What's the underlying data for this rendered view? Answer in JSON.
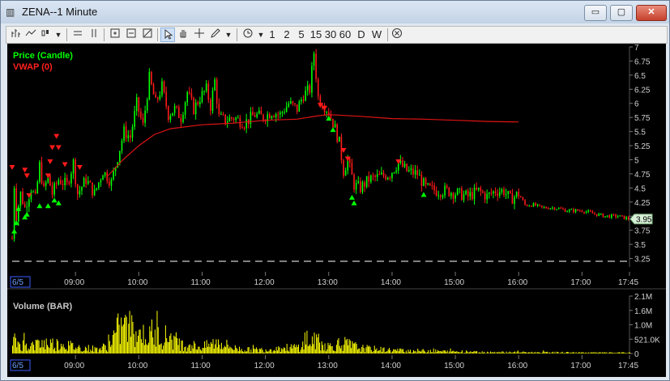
{
  "window": {
    "title": "ZENA--1 Minute",
    "controls": {
      "minimize": "▭",
      "maximize": "▢",
      "close": "✕"
    }
  },
  "toolbar": {
    "icons": [
      "bar-chart-style-icon",
      "line-chart-style-icon",
      "candle-style-icon",
      "dropdown-icon",
      "horizontal-line-icon",
      "vertical-lines-icon",
      "zoom-fit-icon",
      "zoom-in-icon",
      "zoom-out-icon",
      "pointer-icon",
      "hand-pan-icon",
      "crosshair-icon",
      "pen-draw-icon",
      "dropdown-icon",
      "clock-icon",
      "dropdown-icon"
    ],
    "intervals": [
      "1",
      "2",
      "5",
      "15",
      "30",
      "60",
      "D",
      "W"
    ]
  },
  "colors": {
    "price_up": "#00ff00",
    "price_down": "#ff1a1a",
    "vwap": "#e01414",
    "volume": "#ffff00",
    "axis_text": "#d0d0d0",
    "price_legend": "#00ff00",
    "vwap_legend": "#ff2020",
    "last_price_bg": "#d8f0d8"
  },
  "chart_data": [
    {
      "type": "candlestick",
      "legend": [
        "Price (Candle)",
        "VWAP (0)"
      ],
      "y_ticks": [
        "7",
        "6.75",
        "6.5",
        "6.25",
        "6",
        "5.75",
        "5.5",
        "5.25",
        "5",
        "4.75",
        "4.5",
        "4.25",
        "4",
        "3.75",
        "3.5",
        "3.25"
      ],
      "ylim": [
        3.1,
        7.0
      ],
      "x_ticks": [
        "6/5",
        "09:00",
        "10:00",
        "11:00",
        "12:00",
        "13:00",
        "14:00",
        "15:00",
        "16:00",
        "17:00",
        "17:45"
      ],
      "last_price_label": "3.95",
      "price_path": [
        [
          "08:00",
          3.6
        ],
        [
          "08:02",
          4.55
        ],
        [
          "08:04",
          4.0
        ],
        [
          "08:08",
          4.4
        ],
        [
          "08:12",
          4.15
        ],
        [
          "08:18",
          4.5
        ],
        [
          "08:22",
          4.3
        ],
        [
          "08:26",
          4.9
        ],
        [
          "08:30",
          4.45
        ],
        [
          "08:34",
          4.7
        ],
        [
          "08:38",
          4.4
        ],
        [
          "08:44",
          4.65
        ],
        [
          "08:52",
          4.55
        ],
        [
          "08:58",
          4.95
        ],
        [
          "09:02",
          4.4
        ],
        [
          "09:10",
          4.65
        ],
        [
          "09:18",
          4.4
        ],
        [
          "09:26",
          4.8
        ],
        [
          "09:34",
          4.6
        ],
        [
          "09:40",
          5.05
        ],
        [
          "09:46",
          5.5
        ],
        [
          "09:52",
          5.4
        ],
        [
          "09:58",
          6.0
        ],
        [
          "10:04",
          5.6
        ],
        [
          "10:10",
          6.45
        ],
        [
          "10:16",
          6.0
        ],
        [
          "10:22",
          6.3
        ],
        [
          "10:28",
          5.8
        ],
        [
          "10:34",
          5.9
        ],
        [
          "10:40",
          5.75
        ],
        [
          "10:46",
          6.2
        ],
        [
          "10:52",
          5.9
        ],
        [
          "10:58",
          6.1
        ],
        [
          "11:04",
          6.25
        ],
        [
          "11:08",
          5.95
        ],
        [
          "11:12",
          6.4
        ],
        [
          "11:16",
          5.75
        ],
        [
          "11:22",
          5.7
        ],
        [
          "11:30",
          5.75
        ],
        [
          "11:40",
          5.65
        ],
        [
          "11:50",
          5.8
        ],
        [
          "11:58",
          5.75
        ],
        [
          "12:06",
          5.85
        ],
        [
          "12:14",
          5.8
        ],
        [
          "12:22",
          6.0
        ],
        [
          "12:30",
          5.9
        ],
        [
          "12:36",
          6.15
        ],
        [
          "12:42",
          6.25
        ],
        [
          "12:46",
          6.9
        ],
        [
          "12:50",
          6.1
        ],
        [
          "12:56",
          5.95
        ],
        [
          "13:00",
          5.85
        ],
        [
          "13:06",
          5.55
        ],
        [
          "13:10",
          5.3
        ],
        [
          "13:14",
          4.8
        ],
        [
          "13:18",
          5.0
        ],
        [
          "13:24",
          4.55
        ],
        [
          "13:30",
          4.5
        ],
        [
          "13:38",
          4.65
        ],
        [
          "13:48",
          4.7
        ],
        [
          "13:58",
          4.75
        ],
        [
          "14:06",
          4.95
        ],
        [
          "14:14",
          4.8
        ],
        [
          "14:24",
          4.75
        ],
        [
          "14:32",
          4.5
        ],
        [
          "14:42",
          4.45
        ],
        [
          "14:52",
          4.45
        ],
        [
          "15:02",
          4.4
        ],
        [
          "15:12",
          4.35
        ],
        [
          "15:22",
          4.45
        ],
        [
          "15:30",
          4.35
        ],
        [
          "15:38",
          4.45
        ],
        [
          "15:46",
          4.45
        ],
        [
          "15:52",
          4.3
        ],
        [
          "16:00",
          4.4
        ],
        [
          "16:06",
          4.2
        ],
        [
          "16:14",
          4.2
        ],
        [
          "16:22",
          4.15
        ],
        [
          "16:34",
          4.15
        ],
        [
          "16:46",
          4.1
        ],
        [
          "17:00",
          4.1
        ],
        [
          "17:10",
          4.05
        ],
        [
          "17:22",
          4.0
        ],
        [
          "17:34",
          4.0
        ],
        [
          "17:45",
          3.95
        ]
      ],
      "vwap_path": [
        [
          "09:30",
          4.7
        ],
        [
          "09:45",
          5.0
        ],
        [
          "10:00",
          5.25
        ],
        [
          "10:15",
          5.45
        ],
        [
          "10:30",
          5.55
        ],
        [
          "11:00",
          5.62
        ],
        [
          "11:30",
          5.65
        ],
        [
          "12:00",
          5.7
        ],
        [
          "12:30",
          5.72
        ],
        [
          "12:50",
          5.78
        ],
        [
          "13:00",
          5.8
        ],
        [
          "13:30",
          5.77
        ],
        [
          "14:00",
          5.73
        ],
        [
          "14:30",
          5.72
        ],
        [
          "15:00",
          5.7
        ],
        [
          "15:30",
          5.68
        ],
        [
          "16:00",
          5.67
        ]
      ],
      "sell_signals": [
        [
          "08:00",
          4.85
        ],
        [
          "08:12",
          4.8
        ],
        [
          "08:14",
          4.7
        ],
        [
          "08:16",
          4.35
        ],
        [
          "08:34",
          4.7
        ],
        [
          "08:36",
          4.95
        ],
        [
          "08:38",
          5.2
        ],
        [
          "08:42",
          5.4
        ],
        [
          "08:44",
          5.2
        ],
        [
          "08:50",
          4.9
        ],
        [
          "09:04",
          4.85
        ],
        [
          "12:52",
          5.95
        ],
        [
          "12:56",
          5.9
        ],
        [
          "13:14",
          5.15
        ],
        [
          "13:18",
          5.0
        ],
        [
          "14:06",
          4.95
        ]
      ],
      "buy_signals": [
        [
          "08:02",
          3.75
        ],
        [
          "08:04",
          3.9
        ],
        [
          "08:06",
          4.15
        ],
        [
          "08:12",
          4.0
        ],
        [
          "08:14",
          4.05
        ],
        [
          "08:26",
          4.2
        ],
        [
          "08:34",
          4.2
        ],
        [
          "08:40",
          4.3
        ],
        [
          "08:44",
          4.25
        ],
        [
          "13:00",
          5.75
        ],
        [
          "13:04",
          5.55
        ],
        [
          "13:22",
          4.35
        ],
        [
          "13:24",
          4.25
        ],
        [
          "14:30",
          4.4
        ]
      ],
      "baseline_dashed": 3.2
    },
    {
      "type": "bar",
      "legend": [
        "Volume (BAR)"
      ],
      "y_ticks": [
        "2.1M",
        "1.6M",
        "1.0M",
        "521.0K",
        "0"
      ],
      "ylim": [
        0,
        2100000
      ],
      "x_ticks": [
        "6/5",
        "09:00",
        "10:00",
        "11:00",
        "12:00",
        "13:00",
        "14:00",
        "15:00",
        "16:00",
        "17:00",
        "17:45"
      ],
      "volume_profile": [
        [
          "08:00",
          700000
        ],
        [
          "08:10",
          500000
        ],
        [
          "08:20",
          450000
        ],
        [
          "08:30",
          600000
        ],
        [
          "08:40",
          550000
        ],
        [
          "08:50",
          500000
        ],
        [
          "09:00",
          350000
        ],
        [
          "09:10",
          300000
        ],
        [
          "09:20",
          250000
        ],
        [
          "09:30",
          400000
        ],
        [
          "09:40",
          1300000
        ],
        [
          "09:50",
          1500000
        ],
        [
          "10:00",
          1100000
        ],
        [
          "10:10",
          900000
        ],
        [
          "10:20",
          1000000
        ],
        [
          "10:30",
          900000
        ],
        [
          "10:40",
          500000
        ],
        [
          "10:50",
          450000
        ],
        [
          "11:00",
          350000
        ],
        [
          "11:15",
          650000
        ],
        [
          "11:30",
          300000
        ],
        [
          "11:45",
          200000
        ],
        [
          "12:00",
          220000
        ],
        [
          "12:15",
          300000
        ],
        [
          "12:30",
          350000
        ],
        [
          "12:45",
          700000
        ],
        [
          "13:00",
          400000
        ],
        [
          "13:15",
          550000
        ],
        [
          "13:30",
          300000
        ],
        [
          "14:00",
          180000
        ],
        [
          "14:30",
          150000
        ],
        [
          "15:00",
          100000
        ],
        [
          "15:30",
          80000
        ],
        [
          "16:00",
          70000
        ],
        [
          "16:30",
          60000
        ],
        [
          "17:00",
          50000
        ],
        [
          "17:45",
          40000
        ]
      ]
    }
  ]
}
